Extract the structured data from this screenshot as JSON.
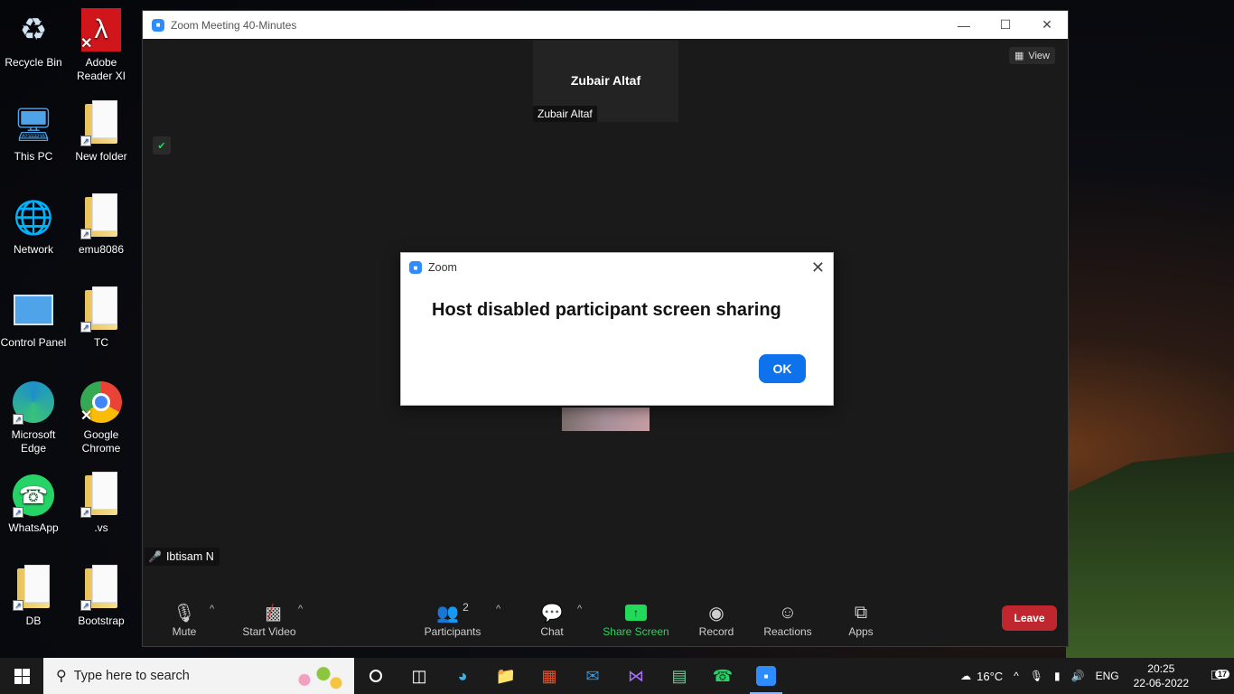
{
  "desktop": {
    "icons": [
      {
        "label": "Recycle Bin",
        "icon": "recycle-bin-icon"
      },
      {
        "label": "Adobe Reader XI",
        "icon": "adobe-reader-icon"
      },
      {
        "label": "This PC",
        "icon": "this-pc-icon"
      },
      {
        "label": "New folder",
        "icon": "folder-icon"
      },
      {
        "label": "Network",
        "icon": "network-icon"
      },
      {
        "label": "emu8086",
        "icon": "folder-icon"
      },
      {
        "label": "Control Panel",
        "icon": "control-panel-icon"
      },
      {
        "label": "TC",
        "icon": "folder-icon"
      },
      {
        "label": "Microsoft Edge",
        "icon": "edge-icon"
      },
      {
        "label": "Google Chrome",
        "icon": "chrome-icon"
      },
      {
        "label": "WhatsApp",
        "icon": "whatsapp-icon"
      },
      {
        "label": ".vs",
        "icon": "folder-icon"
      },
      {
        "label": "DB",
        "icon": "folder-icon"
      },
      {
        "label": "Bootstrap",
        "icon": "folder-icon"
      }
    ]
  },
  "zoom": {
    "window_title": "Zoom Meeting 40-Minutes",
    "view_label": "View",
    "participant_tile": {
      "name_center": "Zubair Altaf",
      "name_label": "Zubair Altaf"
    },
    "self_name": "Ibtisam N",
    "toolbar": {
      "mute": "Mute",
      "start_video": "Start Video",
      "participants": "Participants",
      "participants_count": "2",
      "chat": "Chat",
      "share_screen": "Share Screen",
      "record": "Record",
      "reactions": "Reactions",
      "apps": "Apps",
      "leave": "Leave"
    },
    "colors": {
      "accent": "#0e72ed",
      "share_green": "#23d959",
      "leave_red": "#c0262d"
    }
  },
  "dialog": {
    "title": "Zoom",
    "message": "Host disabled participant screen sharing",
    "ok_label": "OK"
  },
  "taskbar": {
    "search_placeholder": "Type here to search",
    "weather": "16°C",
    "language": "ENG",
    "time": "20:25",
    "date": "22-06-2022",
    "notification_count": "17"
  }
}
